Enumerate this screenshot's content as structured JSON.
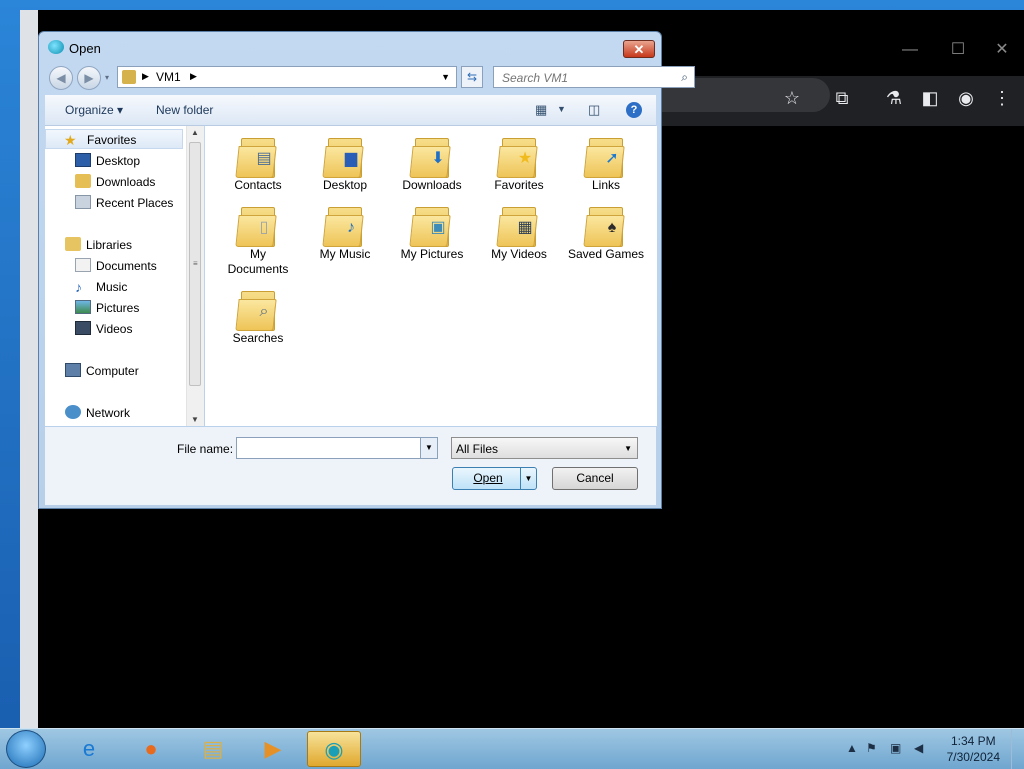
{
  "dialog": {
    "title": "Open",
    "close_label": "✕",
    "address": {
      "path": "VM1"
    },
    "search": {
      "placeholder": "Search VM1"
    },
    "commands": {
      "organize": "Organize ▾",
      "new_folder": "New folder"
    },
    "nav": {
      "favorites": "Favorites",
      "desktop": "Desktop",
      "downloads": "Downloads",
      "recent_places": "Recent Places",
      "libraries": "Libraries",
      "documents": "Documents",
      "music": "Music",
      "pictures": "Pictures",
      "videos": "Videos",
      "computer": "Computer",
      "network": "Network"
    },
    "folders": [
      "Contacts",
      "Desktop",
      "Downloads",
      "Favorites",
      "Links",
      "My Documents",
      "My Music",
      "My Pictures",
      "My Videos",
      "Saved Games",
      "Searches"
    ],
    "file_name_label": "File name:",
    "file_name_value": "",
    "file_type": "All Files",
    "open_label": "Open",
    "cancel_label": "Cancel"
  },
  "taskbar": {
    "time": "1:34 PM",
    "date": "7/30/2024"
  }
}
